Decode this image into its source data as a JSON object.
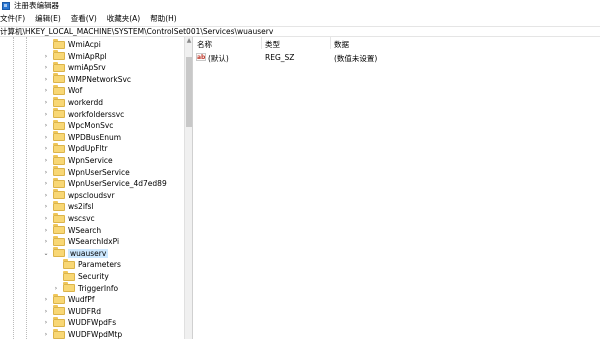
{
  "window": {
    "title": "注册表编辑器"
  },
  "menu": [
    "文件(F)",
    "编辑(E)",
    "查看(V)",
    "收藏夹(A)",
    "帮助(H)"
  ],
  "address": "计算机\\HKEY_LOCAL_MACHINE\\SYSTEM\\ControlSet001\\Services\\wuauserv",
  "tree": [
    {
      "label": "WmiAcpi",
      "level": 1,
      "expander": ""
    },
    {
      "label": "WmiApRpl",
      "level": 1,
      "expander": "›"
    },
    {
      "label": "wmiApSrv",
      "level": 1,
      "expander": "›"
    },
    {
      "label": "WMPNetworkSvc",
      "level": 1,
      "expander": "›"
    },
    {
      "label": "Wof",
      "level": 1,
      "expander": "›"
    },
    {
      "label": "workerdd",
      "level": 1,
      "expander": "›"
    },
    {
      "label": "workfolderssvc",
      "level": 1,
      "expander": "›"
    },
    {
      "label": "WpcMonSvc",
      "level": 1,
      "expander": "›"
    },
    {
      "label": "WPDBusEnum",
      "level": 1,
      "expander": "›"
    },
    {
      "label": "WpdUpFltr",
      "level": 1,
      "expander": "›"
    },
    {
      "label": "WpnService",
      "level": 1,
      "expander": "›"
    },
    {
      "label": "WpnUserService",
      "level": 1,
      "expander": "›"
    },
    {
      "label": "WpnUserService_4d7ed89",
      "level": 1,
      "expander": "›"
    },
    {
      "label": "wpscloudsvr",
      "level": 1,
      "expander": "›"
    },
    {
      "label": "ws2ifsl",
      "level": 1,
      "expander": "›"
    },
    {
      "label": "wscsvc",
      "level": 1,
      "expander": "›"
    },
    {
      "label": "WSearch",
      "level": 1,
      "expander": "›"
    },
    {
      "label": "WSearchIdxPi",
      "level": 1,
      "expander": "›"
    },
    {
      "label": "wuauserv",
      "level": 1,
      "expander": "⌄",
      "selected": true
    },
    {
      "label": "Parameters",
      "level": 2,
      "expander": ""
    },
    {
      "label": "Security",
      "level": 2,
      "expander": ""
    },
    {
      "label": "TriggerInfo",
      "level": 2,
      "expander": "›"
    },
    {
      "label": "WudfPf",
      "level": 1,
      "expander": "›"
    },
    {
      "label": "WUDFRd",
      "level": 1,
      "expander": "›"
    },
    {
      "label": "WUDFWpdFs",
      "level": 1,
      "expander": "›"
    },
    {
      "label": "WUDFWpdMtp",
      "level": 1,
      "expander": "›"
    }
  ],
  "list": {
    "headers": {
      "name": "名称",
      "type": "类型",
      "data": "数据"
    },
    "rows": [
      {
        "icon": "ab",
        "name": "(默认)",
        "type": "REG_SZ",
        "data": "(数值未设置)"
      }
    ]
  }
}
